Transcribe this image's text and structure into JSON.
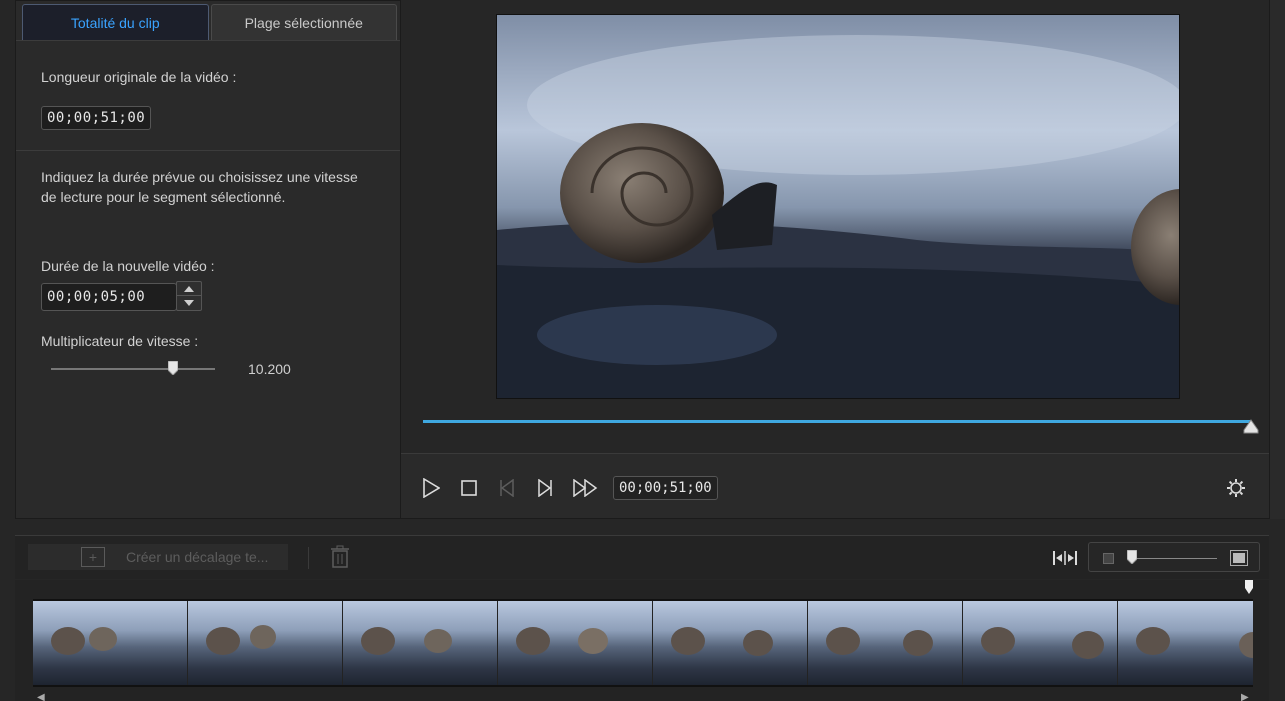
{
  "tabs": {
    "whole_clip": "Totalité du clip",
    "selected_range": "Plage sélectionnée"
  },
  "original": {
    "label": "Longueur originale de la vidéo :",
    "timecode": "00;00;51;00"
  },
  "instructions": {
    "line1": "Indiquez la durée prévue ou choisissez une vitesse",
    "line2": "de lecture pour le segment sélectionné."
  },
  "new_duration": {
    "label": "Durée de la nouvelle vidéo :",
    "timecode": "00;00;05;00"
  },
  "speed": {
    "label": "Multiplicateur de vitesse :",
    "value": "10.200"
  },
  "playback": {
    "timecode": "00;00;51;00",
    "progress_fraction": 1.0
  },
  "toolbar": {
    "offset_label": "Créer un décalage te..."
  },
  "icons": {
    "play": "play-icon",
    "stop": "stop-icon",
    "prev_frame": "previous-frame-icon",
    "next_frame": "next-frame-icon",
    "fast_forward": "fast-forward-icon",
    "settings": "gear-icon",
    "trash": "trash-icon",
    "fit": "fit-timeline-icon"
  },
  "colors": {
    "accent": "#3aa3ff",
    "progress": "#3fa8e0"
  }
}
